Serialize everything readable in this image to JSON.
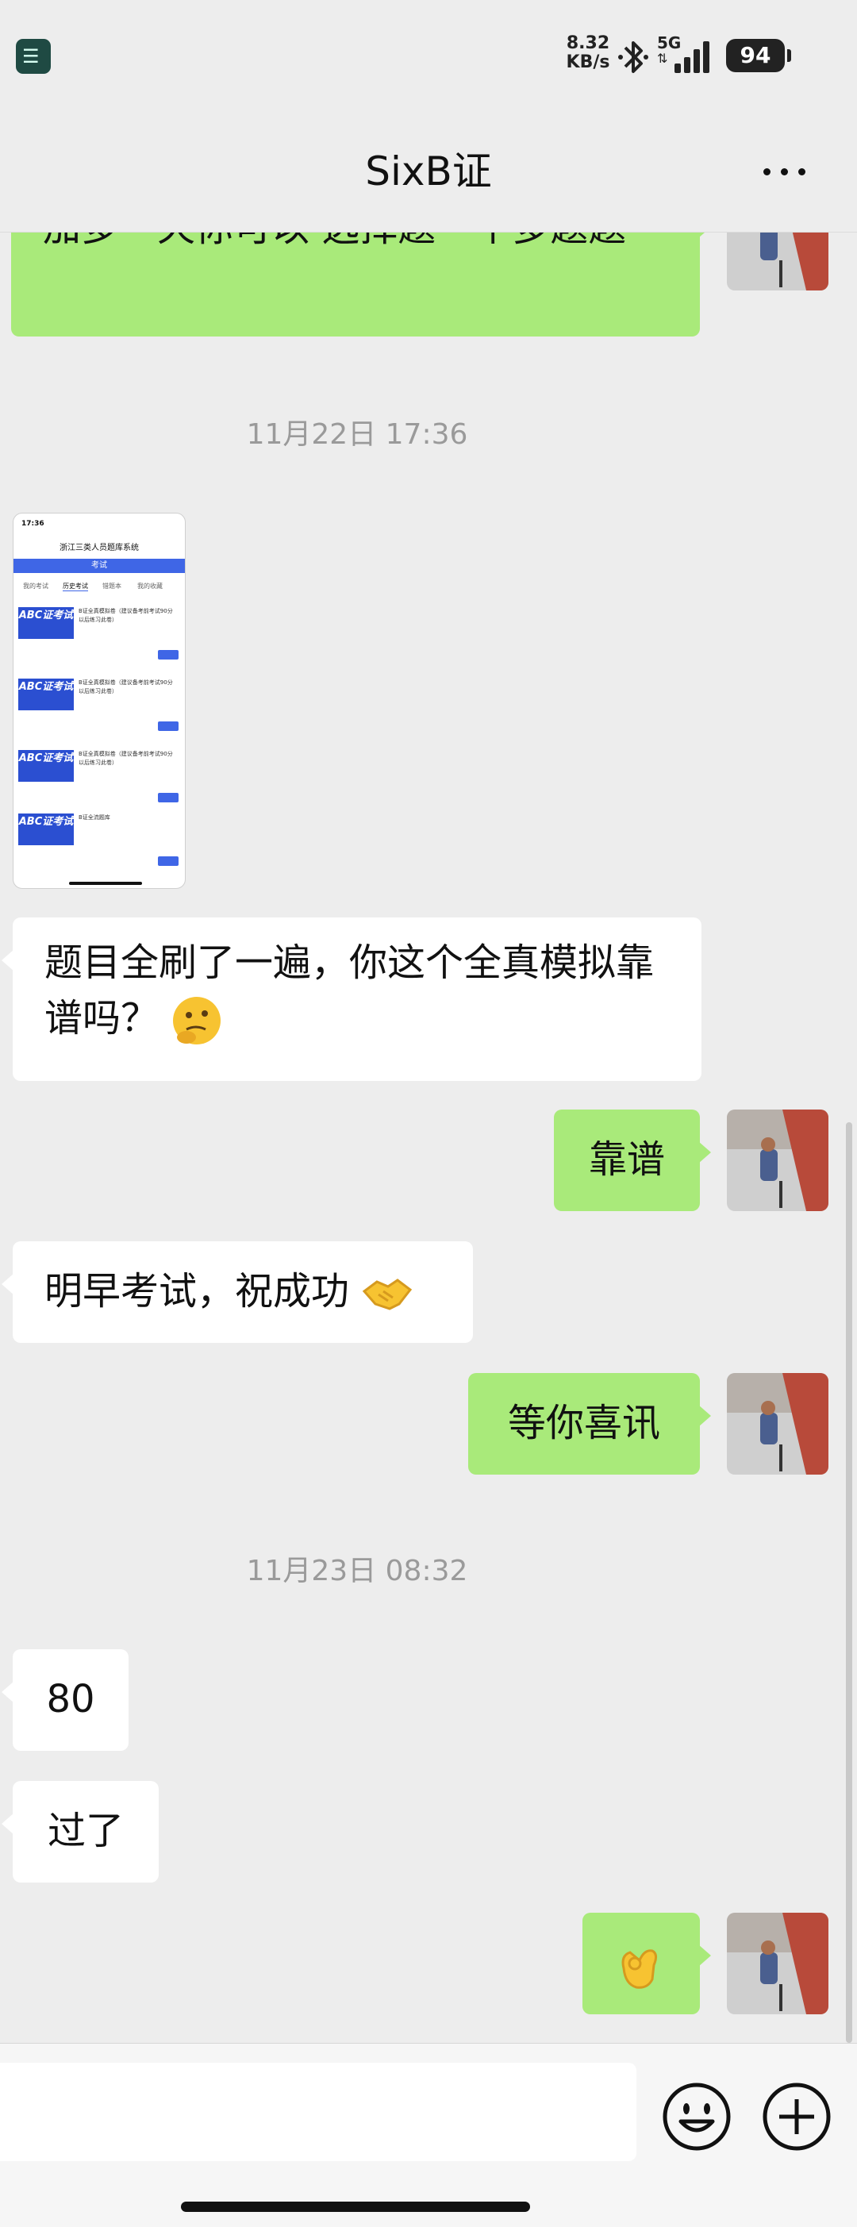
{
  "status_bar": {
    "net_speed_value": "8.32",
    "net_speed_unit": "KB/s",
    "signal_label": "5G",
    "battery": "94"
  },
  "header": {
    "title": "SixB证"
  },
  "messages": {
    "m1_text": "加多一天你可以 选择题一个多题题",
    "ts1": "11月22日 17:36",
    "thumb": {
      "time": "17:36",
      "app_title": "浙江三类人员题库系统",
      "bar_label": "考试",
      "tabs": [
        "我的考试",
        "历史考试",
        "错题本",
        "我的收藏"
      ],
      "items": [
        {
          "logo": "ABC证考试",
          "title": "B证全真模拟卷（建议备考前考试90分以后练习此卷）"
        },
        {
          "logo": "ABC证考试",
          "title": "B证全真模拟卷（建议备考前考试90分以后练习此卷）"
        },
        {
          "logo": "ABC证考试",
          "title": "B证全真模拟卷（建议备考前考试90分以后练习此卷）"
        },
        {
          "logo": "ABC证考试",
          "title": "B证全流题库"
        }
      ]
    },
    "m2_text": "题目全刷了一遍，你这个全真模拟靠谱吗？",
    "m3_text": "靠谱",
    "m4_text": "明早考试，祝成功",
    "m5_text": "等你喜讯",
    "ts2": "11月23日 08:32",
    "m6_text": "80",
    "m7_text": "过了"
  },
  "colors": {
    "background": "#ededed",
    "outgoing_bubble": "#a9ea7a",
    "incoming_bubble": "#ffffff",
    "accent_blue": "#3f66e6"
  },
  "icons": {
    "more": "more-dots-icon",
    "emoji_button": "smiley-icon",
    "plus_button": "plus-circle-icon",
    "thinking_emoji": "thinking-face-emoji",
    "handshake_emoji": "handshake-emoji",
    "ok_emoji": "ok-hand-emoji"
  }
}
